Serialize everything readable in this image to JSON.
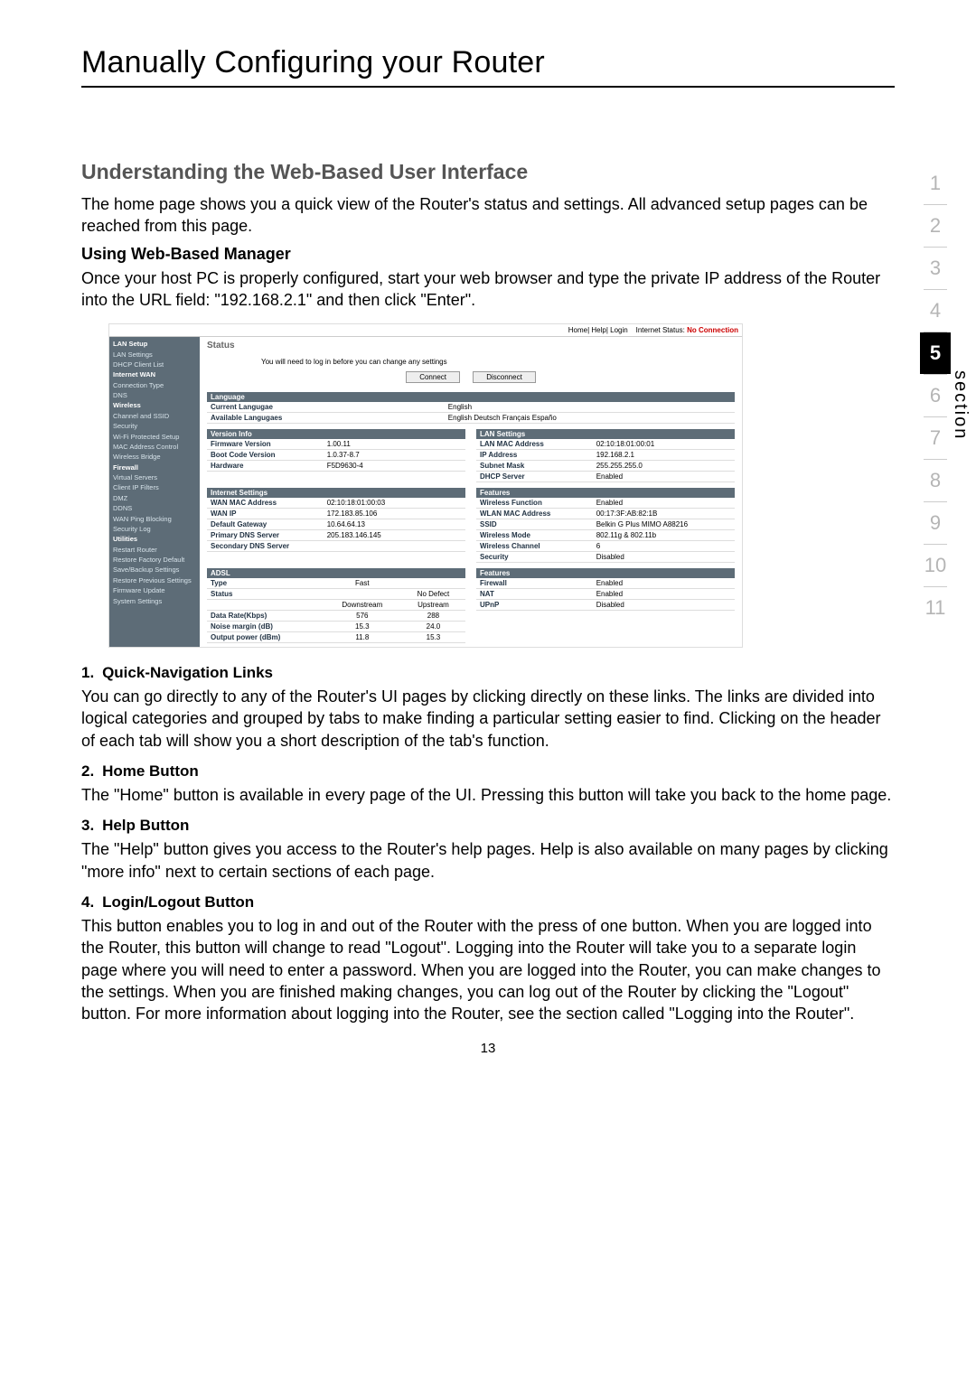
{
  "page": {
    "title": "Manually Configuring your Router",
    "section_heading": "Understanding the Web-Based User Interface",
    "intro": "The home page shows you a quick view of the Router's status and settings. All advanced setup pages can be reached from this page.",
    "sub1": "Using Web-Based Manager",
    "sub1_body": "Once your host PC is properly configured, start your web browser and type the private IP address of the Router into the URL field: \"192.168.2.1\" and then click \"Enter\".",
    "items": [
      {
        "n": "1.",
        "t": "Quick-Navigation Links",
        "b": "You can go directly to any of the Router's UI pages by clicking directly on these links. The links are divided into logical categories and grouped by tabs to make finding a particular setting easier to find. Clicking on the header of each tab will show you a short description of the tab's function."
      },
      {
        "n": "2.",
        "t": "Home Button",
        "b": "The \"Home\" button is available in every page of the UI. Pressing this button will take you back to the home page."
      },
      {
        "n": "3.",
        "t": "Help Button",
        "b": "The \"Help\" button gives you access to the Router's help pages. Help is also available on many pages by clicking \"more info\" next to certain sections of each page."
      },
      {
        "n": "4.",
        "t": "Login/Logout Button",
        "b": "This button enables you to log in and out of the Router with the press of one button. When you are logged into the Router, this button will change to read \"Logout\". Logging into the Router will take you to a separate login page where you will need to enter a password. When you are logged into the Router, you can make changes to the settings. When you are finished making changes, you can log out of the Router by clicking the \"Logout\" button. For more information about logging into the Router, see the section called \"Logging into the Router\"."
      }
    ],
    "page_number": "13"
  },
  "tabs": {
    "label": "section",
    "items": [
      "1",
      "2",
      "3",
      "4",
      "5",
      "6",
      "7",
      "8",
      "9",
      "10",
      "11"
    ],
    "current_index": 4
  },
  "router": {
    "topbar": {
      "links": "Home| Help| Login",
      "status_label": "Internet Status:",
      "status_value": "No Connection"
    },
    "nav": [
      {
        "t": "LAN Setup",
        "c": "hdr"
      },
      {
        "t": "LAN Settings",
        "c": "sub"
      },
      {
        "t": "DHCP Client List",
        "c": "sub"
      },
      {
        "t": "Internet WAN",
        "c": "hdr"
      },
      {
        "t": "Connection Type",
        "c": "sub"
      },
      {
        "t": "DNS",
        "c": "sub"
      },
      {
        "t": "Wireless",
        "c": "hdr"
      },
      {
        "t": "Channel and SSID",
        "c": "sub"
      },
      {
        "t": "Security",
        "c": "sub"
      },
      {
        "t": "Wi-Fi Protected Setup",
        "c": "sub"
      },
      {
        "t": "MAC Address Control",
        "c": "sub"
      },
      {
        "t": "Wireless Bridge",
        "c": "sub"
      },
      {
        "t": "Firewall",
        "c": "hdr"
      },
      {
        "t": "Virtual Servers",
        "c": "sub"
      },
      {
        "t": "Client IP Filters",
        "c": "sub"
      },
      {
        "t": "DMZ",
        "c": "sub"
      },
      {
        "t": "DDNS",
        "c": "sub"
      },
      {
        "t": "WAN Ping Blocking",
        "c": "sub"
      },
      {
        "t": "Security Log",
        "c": "sub"
      },
      {
        "t": "Utilities",
        "c": "hdr"
      },
      {
        "t": "Restart Router",
        "c": "sub"
      },
      {
        "t": "Restore Factory Default",
        "c": "sub"
      },
      {
        "t": "Save/Backup Settings",
        "c": "sub"
      },
      {
        "t": "Restore Previous Settings",
        "c": "sub"
      },
      {
        "t": "Firmware Update",
        "c": "sub"
      },
      {
        "t": "System Settings",
        "c": "sub"
      }
    ],
    "status_title": "Status",
    "note": "You will need to log in before you can change any settings",
    "connect_btn": "Connect",
    "disconnect_btn": "Disconnect",
    "language": {
      "title": "Language",
      "rows": [
        [
          "Current Langugae",
          "English"
        ],
        [
          "Available Langugaes",
          "English Deutsch Français Españo"
        ]
      ]
    },
    "version": {
      "title": "Version Info",
      "rows": [
        [
          "Firmware Version",
          "1.00.11"
        ],
        [
          "Boot Code Version",
          "1.0.37-8.7"
        ],
        [
          "Hardware",
          "F5D9630-4"
        ]
      ]
    },
    "lan": {
      "title": "LAN Settings",
      "rows": [
        [
          "LAN MAC Address",
          "02:10:18:01:00:01"
        ],
        [
          "IP Address",
          "192.168.2.1"
        ],
        [
          "Subnet Mask",
          "255.255.255.0"
        ],
        [
          "DHCP Server",
          "Enabled"
        ]
      ]
    },
    "internet": {
      "title": "Internet Settings",
      "rows": [
        [
          "WAN MAC Address",
          "02:10:18:01:00:03"
        ],
        [
          "WAN IP",
          "172.183.85.106"
        ],
        [
          "Default Gateway",
          "10.64.64.13"
        ],
        [
          "Primary DNS Server",
          "205.183.146.145"
        ],
        [
          "Secondary DNS Server",
          ""
        ]
      ]
    },
    "features": {
      "title": "Features",
      "rows": [
        [
          "Wireless Function",
          "Enabled"
        ],
        [
          "WLAN MAC Address",
          "00:17:3F:AB:82:1B"
        ],
        [
          "SSID",
          "Belkin G Plus MIMO A88216"
        ],
        [
          "Wireless Mode",
          "802.11g & 802.11b"
        ],
        [
          "Wireless Channel",
          "6"
        ],
        [
          "Security",
          "Disabled"
        ]
      ]
    },
    "adsl": {
      "title": "ADSL",
      "type_row": [
        "Type",
        "Fast"
      ],
      "status_row": [
        "Status",
        "No Defect"
      ],
      "head": [
        "",
        "Downstream",
        "Upstream"
      ],
      "rows": [
        [
          "Data Rate(Kbps)",
          "576",
          "288"
        ],
        [
          "Noise margin (dB)",
          "15.3",
          "24.0"
        ],
        [
          "Output power (dBm)",
          "11.8",
          "15.3"
        ]
      ]
    },
    "features2": {
      "title": "Features",
      "rows": [
        [
          "Firewall",
          "Enabled"
        ],
        [
          "NAT",
          "Enabled"
        ],
        [
          "UPnP",
          "Disabled"
        ]
      ]
    }
  }
}
